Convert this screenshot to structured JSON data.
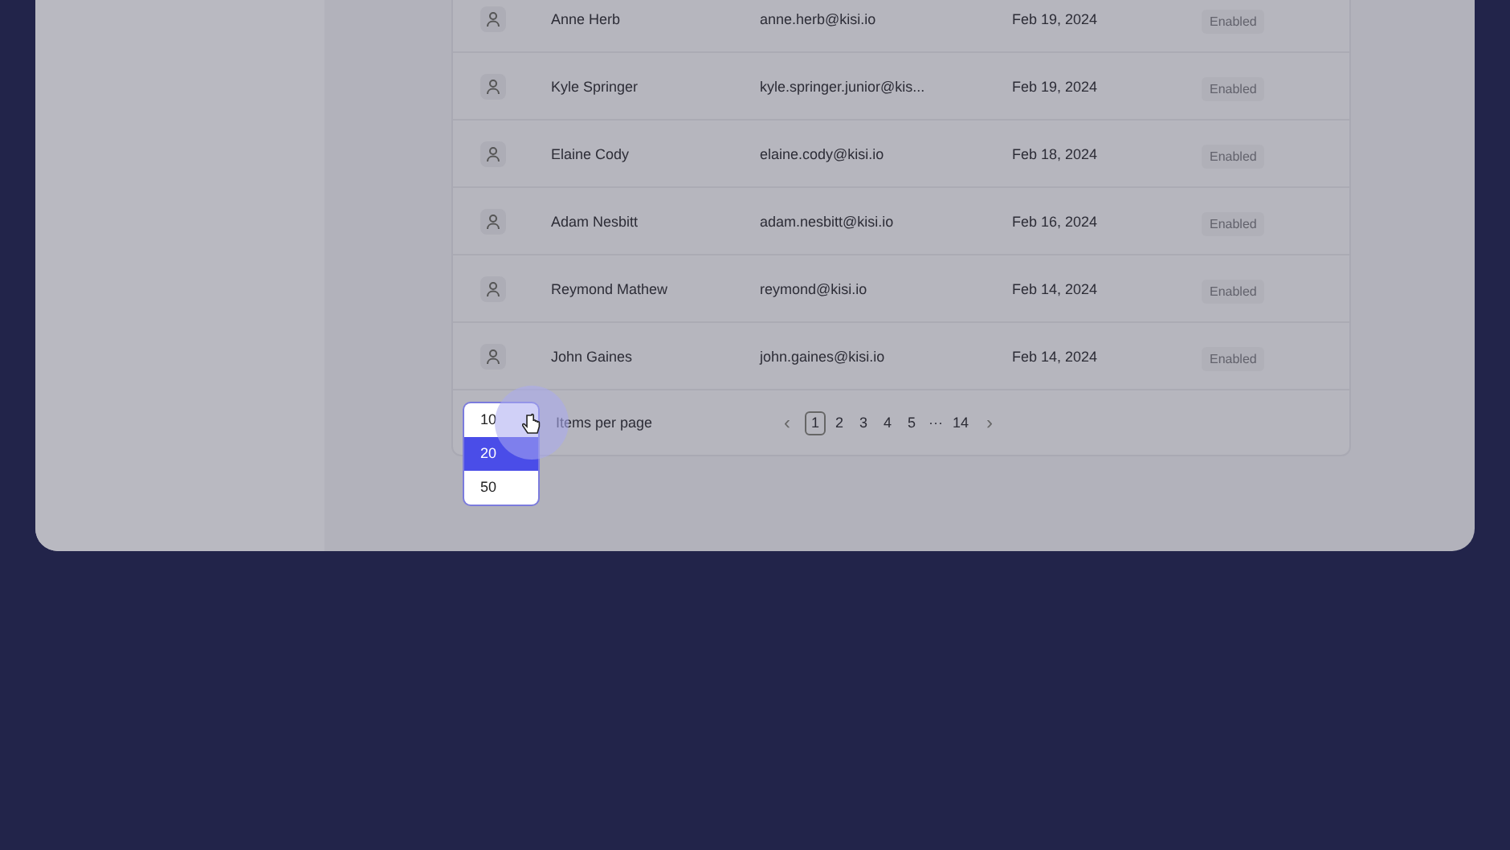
{
  "users": [
    {
      "name": "Anne Herb",
      "email": "anne.herb@kisi.io",
      "date": "Feb 19, 2024",
      "status": "Enabled"
    },
    {
      "name": "Kyle Springer",
      "email": "kyle.springer.junior@kis...",
      "date": "Feb 19, 2024",
      "status": "Enabled"
    },
    {
      "name": "Elaine Cody",
      "email": "elaine.cody@kisi.io",
      "date": "Feb 18, 2024",
      "status": "Enabled"
    },
    {
      "name": "Adam Nesbitt",
      "email": "adam.nesbitt@kisi.io",
      "date": "Feb 16, 2024",
      "status": "Enabled"
    },
    {
      "name": "Reymond Mathew",
      "email": "reymond@kisi.io",
      "date": "Feb 14, 2024",
      "status": "Enabled"
    },
    {
      "name": "John Gaines",
      "email": "john.gaines@kisi.io",
      "date": "Feb 14, 2024",
      "status": "Enabled"
    }
  ],
  "per_page": {
    "label": "Items per page",
    "options": [
      {
        "label": "10",
        "selected": false
      },
      {
        "label": "20",
        "selected": true
      },
      {
        "label": "50",
        "selected": false
      }
    ]
  },
  "pagination": {
    "prev": "‹",
    "next": "›",
    "pages": [
      {
        "label": "1",
        "selected": true
      },
      {
        "label": "2",
        "selected": false
      },
      {
        "label": "3",
        "selected": false
      },
      {
        "label": "4",
        "selected": false
      },
      {
        "label": "5",
        "selected": false
      },
      {
        "label": "···",
        "selected": false
      },
      {
        "label": "14",
        "selected": false
      }
    ]
  }
}
